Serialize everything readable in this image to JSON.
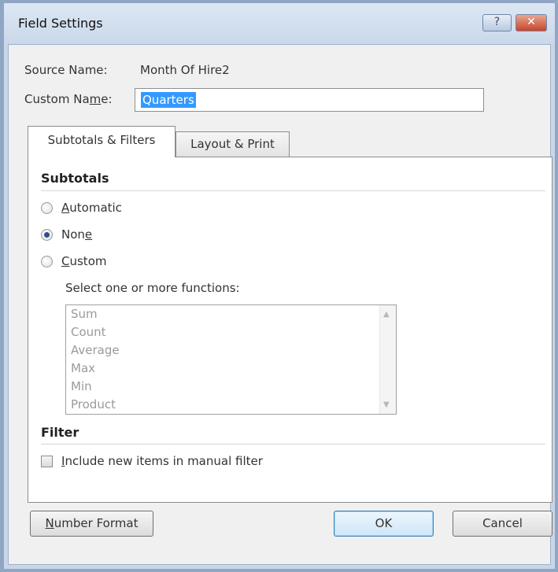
{
  "window": {
    "title": "Field Settings",
    "help_glyph": "?",
    "close_glyph": "✕"
  },
  "source": {
    "label": "Source Name:",
    "value": "Month Of Hire2"
  },
  "custom_name": {
    "label_pre": "Custom Na",
    "label_underline": "m",
    "label_post": "e:",
    "value": "Quarters"
  },
  "tabs": [
    {
      "label": "Subtotals & Filters",
      "active": true
    },
    {
      "label": "Layout & Print",
      "active": false
    }
  ],
  "subtotals": {
    "title": "Subtotals",
    "options": [
      {
        "underline": "A",
        "rest": "utomatic",
        "checked": false
      },
      {
        "pre": "Non",
        "underline": "e",
        "checked": true
      },
      {
        "underline": "C",
        "rest": "ustom",
        "checked": false
      }
    ],
    "functions_label": "Select one or more functions:",
    "functions": [
      "Sum",
      "Count",
      "Average",
      "Max",
      "Min",
      "Product"
    ]
  },
  "filter": {
    "title": "Filter",
    "checkbox_underline": "I",
    "checkbox_rest": "nclude new items in manual filter",
    "checked": false
  },
  "buttons": {
    "number_format_underline": "N",
    "number_format_rest": "umber Format",
    "ok": "OK",
    "cancel": "Cancel"
  }
}
